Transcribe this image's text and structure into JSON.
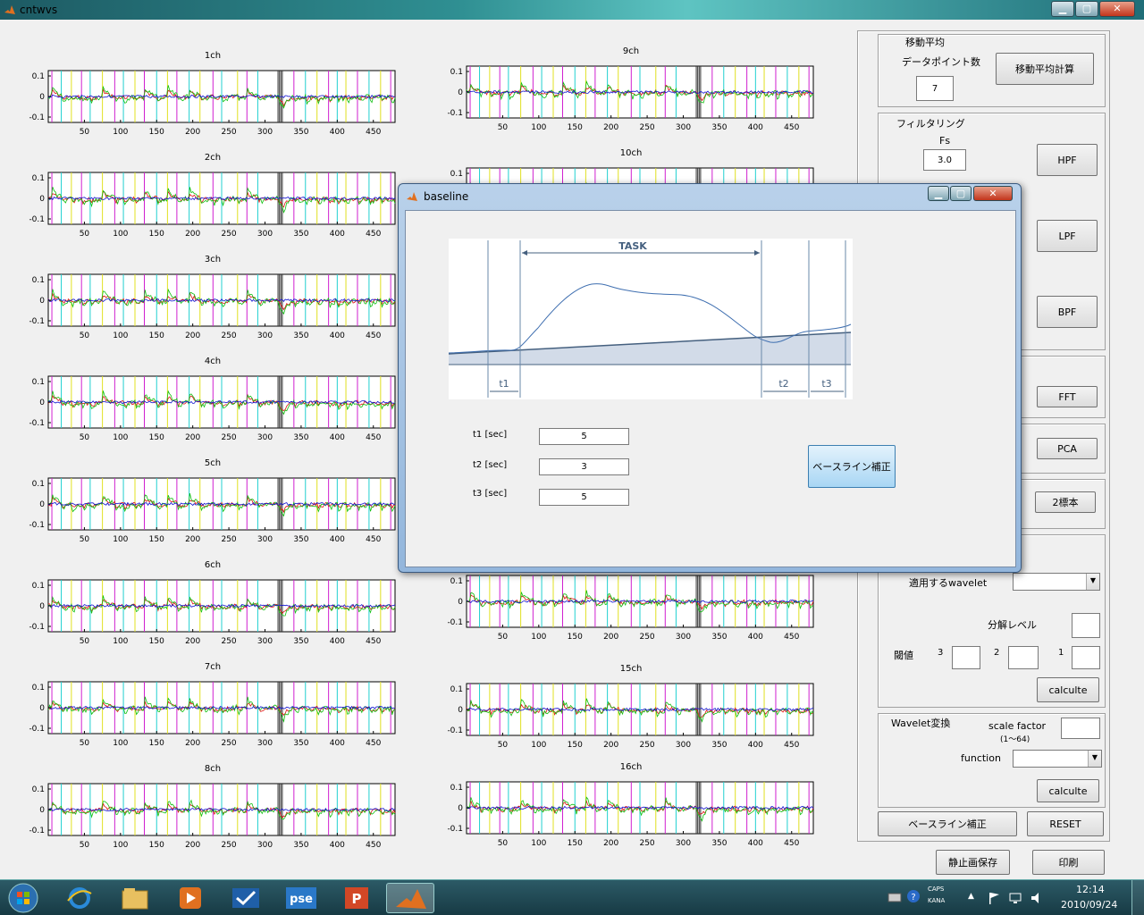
{
  "window": {
    "title": "cntwvs"
  },
  "plots": {
    "ytick_labels": [
      "0.1",
      "0",
      "-0.1"
    ],
    "xtick_labels": [
      "50",
      "100",
      "150",
      "200",
      "250",
      "300",
      "350",
      "400",
      "450"
    ],
    "left_titles": [
      "1ch",
      "2ch",
      "3ch",
      "4ch",
      "5ch",
      "6ch",
      "7ch",
      "8ch"
    ],
    "right_titles": [
      "9ch",
      "10ch",
      "",
      "",
      "",
      "",
      "15ch",
      "16ch"
    ]
  },
  "panel": {
    "moving_average": {
      "title": "移動平均",
      "points_label": "データポイント数",
      "points_value": "7",
      "button": "移動平均計算"
    },
    "filtering": {
      "title": "フィルタリング",
      "fs_label": "Fs",
      "fs_value": "3.0",
      "hpf": "HPF",
      "lpf": "LPF",
      "bpf": "BPF"
    },
    "fft": "FFT",
    "pca": "PCA",
    "two_sample": "2標本",
    "wavelet_apply": {
      "label": "適用するwavelet",
      "level_label": "分解レベル",
      "threshold_label": "閾値",
      "n3": "3",
      "n2": "2",
      "n1": "1",
      "button": "calculte"
    },
    "wavelet_transform": {
      "title": "Wavelet変換",
      "scale_label": "scale factor",
      "scale_range": "(1〜64)",
      "function_label": "function",
      "button": "calculte"
    },
    "baseline_button": "ベースライン補正",
    "reset_button": "RESET",
    "save_button": "静止画保存",
    "print_button": "印刷"
  },
  "dialog": {
    "title": "baseline",
    "diagram": {
      "task_label": "TASK",
      "t1": "t1",
      "t2": "t2",
      "t3": "t3"
    },
    "t1_label": "t1 [sec]",
    "t1_value": "5",
    "t2_label": "t2 [sec]",
    "t2_value": "3",
    "t3_label": "t3 [sec]",
    "t3_value": "5",
    "apply_button": "ベースライン補正"
  },
  "taskbar": {
    "time": "12:14",
    "date": "2010/09/24",
    "caps": "CAPS",
    "kana": "KANA",
    "app_icons": [
      "start-orb-icon",
      "internet-explorer-icon",
      "file-explorer-icon",
      "media-player-icon",
      "task-check-icon",
      "pse-icon",
      "powerpoint-icon",
      "matlab-icon"
    ],
    "pse_label": "pse"
  },
  "colors": {
    "ch_red": "#e01010",
    "ch_green": "#10c010",
    "ch_blue": "#1010d0",
    "marker_magenta": "#d020d0",
    "marker_cyan": "#20d0d0",
    "marker_yellow": "#e0e020"
  }
}
